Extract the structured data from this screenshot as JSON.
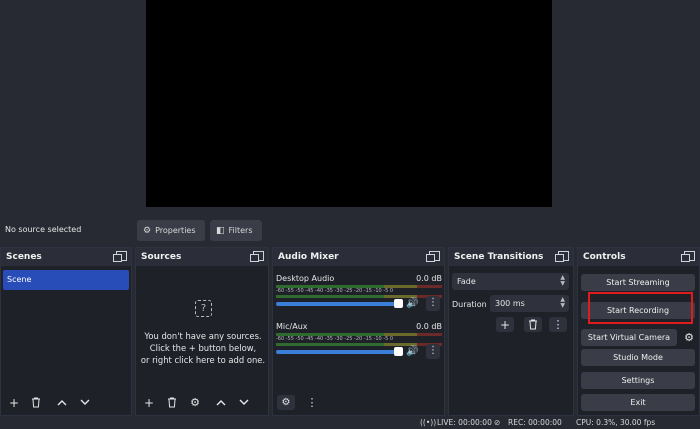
{
  "source_bar": {
    "status": "No source selected",
    "properties_label": "Properties",
    "filters_label": "Filters"
  },
  "scenes": {
    "title": "Scenes",
    "items": [
      "Scene"
    ]
  },
  "sources": {
    "title": "Sources",
    "empty_line1": "You don't have any sources.",
    "empty_line2": "Click the + button below,",
    "empty_line3": "or right click here to add one."
  },
  "mixer": {
    "title": "Audio Mixer",
    "ticks": "-60 -55 -50 -45 -40 -35 -30 -25 -20 -15 -10 -5 0",
    "channels": [
      {
        "name": "Desktop Audio",
        "db": "0.0 dB",
        "volume": 1.0
      },
      {
        "name": "Mic/Aux",
        "db": "0.0 dB",
        "volume": 1.0
      }
    ]
  },
  "transitions": {
    "title": "Scene Transitions",
    "transition": "Fade",
    "duration_label": "Duration",
    "duration_value": "300 ms"
  },
  "controls": {
    "title": "Controls",
    "start_streaming": "Start Streaming",
    "start_recording": "Start Recording",
    "start_virtual_camera": "Start Virtual Camera",
    "studio_mode": "Studio Mode",
    "settings": "Settings",
    "exit": "Exit"
  },
  "status": {
    "live": "LIVE: 00:00:00",
    "rec": "REC: 00:00:00",
    "cpu": "CPU: 0.3%, 30.00 fps"
  },
  "colors": {
    "accent": "#284cb8",
    "highlight": "#e11b1b",
    "slider": "#3b7ed8"
  }
}
